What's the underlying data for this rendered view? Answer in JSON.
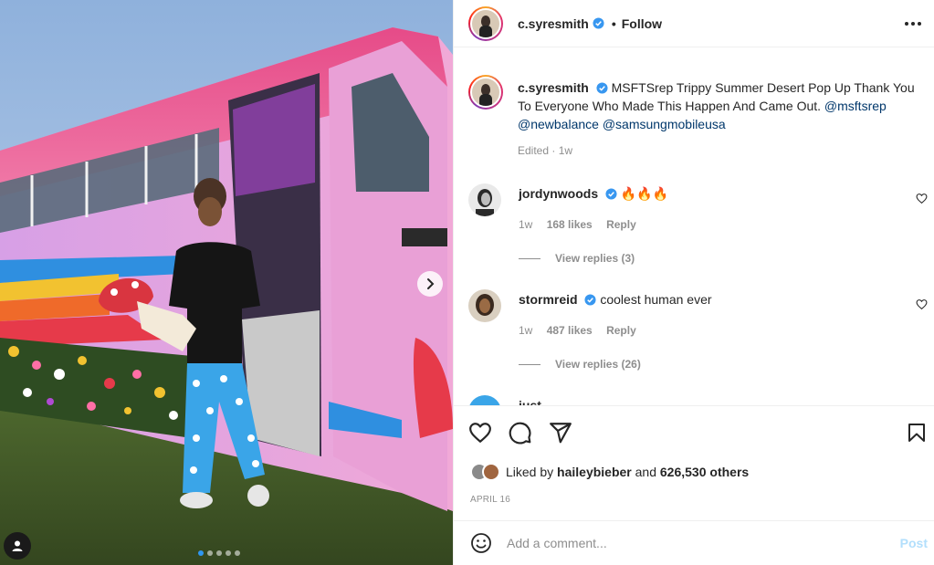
{
  "post": {
    "username": "c.syresmith",
    "follow_label": "Follow",
    "separator": "•",
    "caption_username": "c.syresmith",
    "caption_text": "MSFTSrep Trippy Summer Desert Pop Up Thank You To Everyone Who Made This Happen And Came Out.",
    "mentions": [
      "@msftsrep",
      "@newbalance",
      "@samsungmobileusa"
    ],
    "edited": "Edited · 1w",
    "carousel": {
      "count": 5,
      "active_index": 0
    }
  },
  "comments": [
    {
      "username": "jordynwoods",
      "text": "🔥🔥🔥",
      "time": "1w",
      "likes": "168 likes",
      "reply": "Reply",
      "view_replies": "View replies (3)"
    },
    {
      "username": "stormreid",
      "text": "coolest human ever",
      "time": "1w",
      "likes": "487 likes",
      "reply": "Reply",
      "view_replies": "View replies (26)"
    },
    {
      "username": "just",
      "text": ""
    }
  ],
  "liked_by": {
    "prefix": "Liked by",
    "user": "haileybieber",
    "and": "and",
    "others": "626,530 others"
  },
  "date": "APRIL 16",
  "add_comment": {
    "placeholder": "Add a comment...",
    "post_label": "Post"
  },
  "icons": {
    "more": "more-options-icon",
    "verified": "verified-badge-icon",
    "like": "heart-icon",
    "comment": "comment-icon",
    "share": "share-icon",
    "save": "bookmark-icon",
    "emoji": "emoji-icon",
    "tag": "user-tag-icon",
    "next": "chevron-right-icon"
  },
  "colors": {
    "verified": "#3897f0",
    "link": "#00376b",
    "post_disabled": "#b2dffc"
  }
}
